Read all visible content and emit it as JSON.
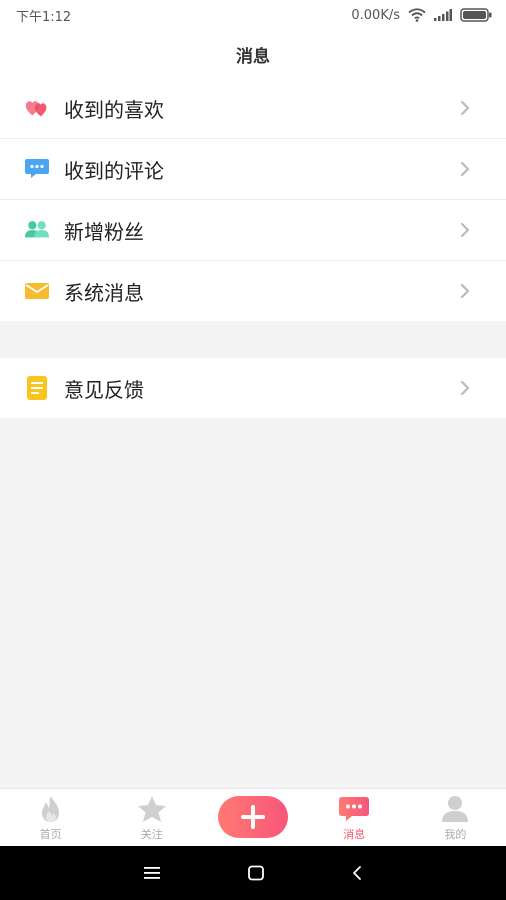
{
  "status_bar": {
    "time": "下午1:12",
    "speed": "0.00K/s"
  },
  "header": {
    "title": "消息"
  },
  "menu_group_1": [
    {
      "label": "收到的喜欢",
      "icon": "hearts-icon"
    },
    {
      "label": "收到的评论",
      "icon": "comment-bubble-icon"
    },
    {
      "label": "新增粉丝",
      "icon": "fans-icon"
    },
    {
      "label": "系统消息",
      "icon": "envelope-icon"
    }
  ],
  "menu_group_2": [
    {
      "label": "意见反馈",
      "icon": "document-icon"
    }
  ],
  "tabs": [
    {
      "label": "首页",
      "icon": "flame-icon",
      "active": false
    },
    {
      "label": "关注",
      "icon": "star-icon",
      "active": false
    },
    {
      "label": "消息",
      "icon": "message-icon",
      "active": true
    },
    {
      "label": "我的",
      "icon": "person-icon",
      "active": false
    }
  ],
  "colors": {
    "accent": "#f2566f",
    "plus_gradient_start": "#ff7a72",
    "plus_gradient_end": "#f8567a",
    "background": "#f4f4f4"
  }
}
